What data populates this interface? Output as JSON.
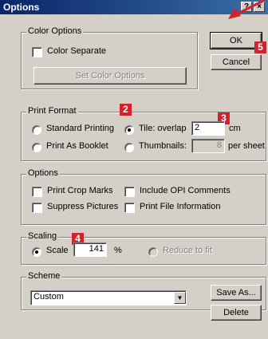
{
  "window": {
    "title": "Options",
    "help_glyph": "?",
    "close_glyph": "×"
  },
  "color_options": {
    "legend": "Color Options",
    "color_separate": {
      "label": "Color Separate",
      "mnemonic": "C",
      "checked": false
    },
    "set_color_button": "Set Color Options"
  },
  "dialog_buttons": {
    "ok": "OK",
    "cancel": "Cancel"
  },
  "print_format": {
    "legend": "Print Format",
    "standard_printing": {
      "label": "Standard Printing",
      "selected": false
    },
    "tile": {
      "label": "Tile: overlap",
      "selected": true,
      "value": "2",
      "unit": "cm"
    },
    "print_as_booklet": {
      "label": "Print As Booklet",
      "selected": false
    },
    "thumbnails": {
      "label": "Thumbnails:",
      "selected": false,
      "value": "8",
      "unit": "per sheet"
    }
  },
  "options": {
    "legend": "Options",
    "print_crop_marks": {
      "label": "Print Crop Marks",
      "checked": false
    },
    "include_opi": {
      "label": "Include OPI Comments",
      "checked": false
    },
    "suppress_pictures": {
      "label": "Suppress Pictures",
      "checked": false
    },
    "print_file_info": {
      "label": "Print File Information",
      "checked": false
    }
  },
  "scaling": {
    "legend": "Scaling",
    "scale": {
      "label": "Scale",
      "selected": true,
      "value": "141",
      "unit": "%"
    },
    "reduce_to_fit": {
      "label": "Reduce to fit",
      "selected": false
    }
  },
  "scheme": {
    "legend": "Scheme",
    "selected": "Custom",
    "save_as_button": "Save As...",
    "delete_button": "Delete"
  },
  "callouts": {
    "b2": "2",
    "b3": "3",
    "b4": "4",
    "b5": "5"
  },
  "colors": {
    "badge": "#d2232a",
    "title_start": "#0a246a",
    "title_end": "#3a6ea5",
    "face": "#d4d0c8"
  }
}
